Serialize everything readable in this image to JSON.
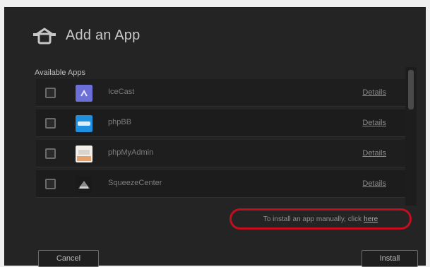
{
  "dialog": {
    "title": "Add an App",
    "title_icon": "add-app-icon",
    "section_label": "Available Apps"
  },
  "apps": [
    {
      "name": "IceCast",
      "details_label": "Details",
      "icon": "icecast-icon",
      "icon_color": "#6b6fd6"
    },
    {
      "name": "phpBB",
      "details_label": "Details",
      "icon": "phpbb-icon",
      "icon_color": "#1f8fe0"
    },
    {
      "name": "phpMyAdmin",
      "details_label": "Details",
      "icon": "phpmyadmin-icon",
      "icon_color": "#e6a26a"
    },
    {
      "name": "SqueezeCenter",
      "details_label": "Details",
      "icon": "squeezecenter-icon",
      "icon_color": "#8a8a8a"
    }
  ],
  "manual_install": {
    "text": "To install an app manually, click",
    "link_label": "here",
    "highlight_color": "#c0101f"
  },
  "buttons": {
    "cancel_label": "Cancel",
    "install_label": "Install"
  }
}
